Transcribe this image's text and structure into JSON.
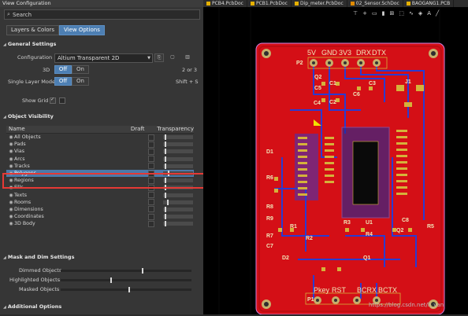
{
  "panel": {
    "title": "View Configuration",
    "search_placeholder": "Search",
    "tabs": [
      {
        "label": "Layers & Colors"
      },
      {
        "label": "View Options"
      }
    ]
  },
  "general": {
    "header": "General Settings",
    "configuration_label": "Configuration",
    "configuration_value": "Altium Transparent 2D",
    "view_3d_label": "3D",
    "view_3d_off": "Off",
    "view_3d_on": "On",
    "view_3d_hint": "2 or 3",
    "single_layer_label": "Single Layer Mode",
    "single_layer_off": "Off",
    "single_layer_on": "On",
    "single_layer_hint": "Shift + S",
    "show_grid_label": "Show Grid"
  },
  "objects": {
    "header": "Object Visibility",
    "col_name": "Name",
    "col_draft": "Draft",
    "col_transparency": "Transparency",
    "rows": [
      {
        "name": "All Objects",
        "t": 0.06
      },
      {
        "name": "Pads",
        "t": 0.06
      },
      {
        "name": "Vias",
        "t": 0.06
      },
      {
        "name": "Arcs",
        "t": 0.06
      },
      {
        "name": "Tracks",
        "t": 0.06
      },
      {
        "name": "Polygons",
        "t": 0.15
      },
      {
        "name": "Regions",
        "t": 0.06
      },
      {
        "name": "Fills",
        "t": 0.06
      },
      {
        "name": "Texts",
        "t": 0.06
      },
      {
        "name": "Rooms",
        "t": 0.12
      },
      {
        "name": "Dimensions",
        "t": 0.06
      },
      {
        "name": "Coordinates",
        "t": 0.06
      },
      {
        "name": "3D Body",
        "t": 0.06
      }
    ]
  },
  "mask": {
    "header": "Mask and Dim Settings",
    "items": [
      {
        "label": "Dimmed Objects",
        "level": 0.62
      },
      {
        "label": "Highlighted Objects",
        "level": 0.38
      },
      {
        "label": "Masked Objects",
        "level": 0.52
      }
    ]
  },
  "additional": {
    "header": "Additional Options"
  },
  "doc_tabs": [
    {
      "label": "PCB4.PcbDoc"
    },
    {
      "label": "PCB1.PcbDoc"
    },
    {
      "label": "Dip_meter.PcbDoc"
    },
    {
      "label": "02_Sensor.SchDoc"
    },
    {
      "label": "BAOGANG1.PCB"
    }
  ],
  "pcb": {
    "header_labels": [
      "5V",
      "GND",
      "3V3",
      "DRX",
      "DTX"
    ],
    "footer_labels": [
      "Pkey",
      "RST",
      "BCRX",
      "BCTX"
    ],
    "refs": [
      "P2",
      "C5",
      "Q2",
      "C4",
      "C6",
      "J1",
      "C1",
      "C2",
      "C3",
      "R6",
      "R7",
      "R8",
      "R9",
      "R1",
      "R2",
      "R3",
      "R4",
      "R5",
      "Q1",
      "Q2",
      "C7",
      "C8",
      "U1",
      "P1",
      "D1",
      "D2"
    ],
    "colors": {
      "board": "#d40f16",
      "trace": "#2a3bd1",
      "pad": "#d5b23a",
      "outline": "#d07fe0"
    }
  },
  "watermark": "https://blog.csdn.net/li_van"
}
